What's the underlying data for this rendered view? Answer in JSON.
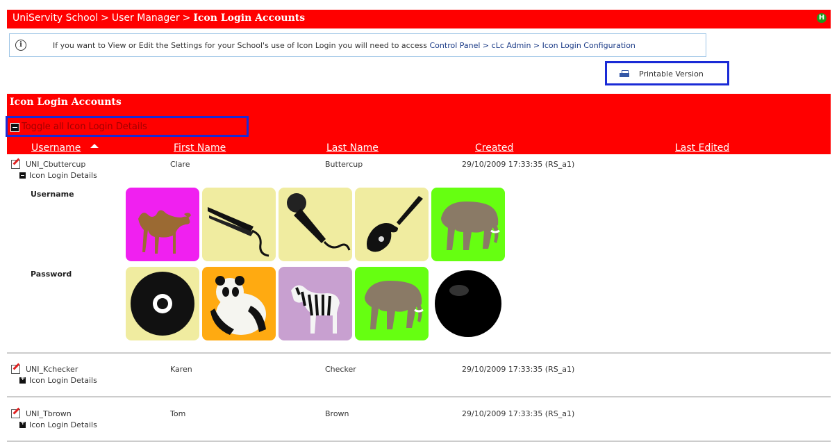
{
  "breadcrumb": {
    "items": [
      "UniServity School",
      "User Manager",
      "Icon Login Accounts"
    ],
    "separator": ">"
  },
  "help_badge": "H",
  "info": {
    "icon": "i",
    "message": "If you want to View or Edit the Settings for your School's use of Icon Login you will need to access ",
    "path": "Control Panel > cLc Admin > Icon Login Configuration"
  },
  "printable_label": "Printable Version",
  "section_title": "Icon Login Accounts",
  "toggle_all_label": "Toggle all Icon Login Details",
  "columns": [
    "Username",
    "First Name",
    "Last Name",
    "Created",
    "Last Edited"
  ],
  "details_label": "Icon Login Details",
  "rows": [
    {
      "username": "UNI_Cbuttercup",
      "first": "Clare",
      "last": "Buttercup",
      "created": "29/10/2009 17:33:35 (RS_a1)",
      "last_edited": "",
      "expanded": true
    },
    {
      "username": "UNI_Kchecker",
      "first": "Karen",
      "last": "Checker",
      "created": "29/10/2009 17:33:35 (RS_a1)",
      "last_edited": "",
      "expanded": false
    },
    {
      "username": "UNI_Tbrown",
      "first": "Tom",
      "last": "Brown",
      "created": "29/10/2009 17:33:35 (RS_a1)",
      "last_edited": "",
      "expanded": false
    }
  ],
  "icon_login": {
    "username_label": "Username",
    "password_label": "Password",
    "username_icons": [
      "camel-icon",
      "hair-straightener-icon",
      "microphone-icon",
      "electric-guitar-icon",
      "elephant-icon"
    ],
    "password_icons": [
      "cd-disc-icon",
      "panda-icon",
      "zebra-icon",
      "elephant-icon",
      "black-ball-icon"
    ]
  },
  "colors": {
    "accent": "#ff0000",
    "highlight_border": "#1a2bd6",
    "tile_magenta": "#f020f0",
    "tile_yellow": "#f0eca0",
    "tile_green": "#66ff11",
    "tile_orange": "#ffaa11",
    "tile_lilac": "#c8a0d0"
  }
}
